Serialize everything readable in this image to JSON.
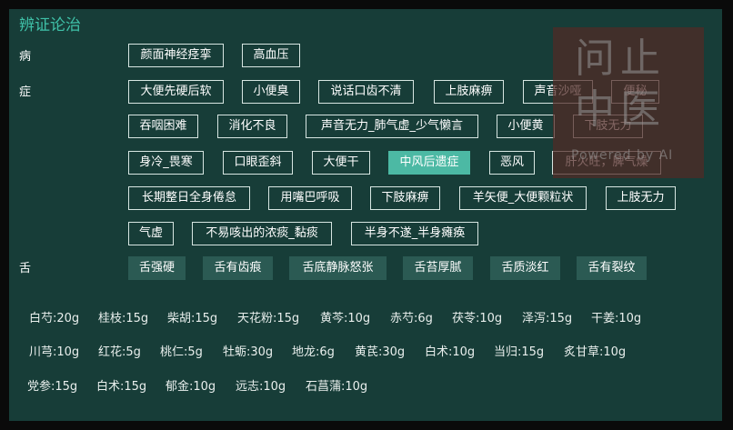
{
  "title": "辨证论治",
  "disease": {
    "label": "病",
    "items": [
      "颜面神经痉挛",
      "高血压"
    ]
  },
  "symptom": {
    "label": "症",
    "row1": [
      "大便先硬后软",
      "小便臭",
      "说话口齿不清",
      "上肢麻痹",
      "声音沙哑",
      "便秘"
    ],
    "row2": [
      "吞咽困难",
      "消化不良",
      "声音无力_肺气虚_少气懒言",
      "小便黄",
      "下肢无力"
    ],
    "row3": [
      "身冷_畏寒",
      "口眼歪斜",
      "大便干",
      "中风后遗症",
      "恶风",
      "肝火旺，脾气燥"
    ],
    "row4": [
      "长期整日全身倦怠",
      "用嘴巴呼吸",
      "下肢麻痹",
      "羊矢便_大便颗粒状",
      "上肢无力"
    ],
    "row5": [
      "气虚",
      "不易咳出的浓痰_黏痰",
      "半身不遂_半身瘫痪"
    ],
    "selected": "中风后遗症"
  },
  "tongue": {
    "label": "舌",
    "items": [
      "舌强硬",
      "舌有齿痕",
      "舌底静脉怒张",
      "舌苔厚腻",
      "舌质淡红",
      "舌有裂纹"
    ]
  },
  "prescription": {
    "row1": [
      "白芍:20g",
      "桂枝:15g",
      "柴胡:15g",
      "天花粉:15g",
      "黄芩:10g",
      "赤芍:6g",
      "茯苓:10g",
      "泽泻:15g",
      "干姜:10g"
    ],
    "row2": [
      "川芎:10g",
      "红花:5g",
      "桃仁:5g",
      "牡蛎:30g",
      "地龙:6g",
      "黄芪:30g",
      "白术:10g",
      "当归:15g",
      "炙甘草:10g"
    ],
    "row3": [
      "党参:15g",
      "白术:15g",
      "郁金:10g",
      "远志:10g",
      "石菖蒲:10g"
    ]
  },
  "watermark": {
    "line1": "问止",
    "line2": "中医",
    "line3": "Powered by AI"
  },
  "colors": {
    "panel": "#173d38",
    "accent": "#3fc1a8",
    "selected": "#4cb9a4",
    "tongue_chip": "#2b5a53"
  }
}
